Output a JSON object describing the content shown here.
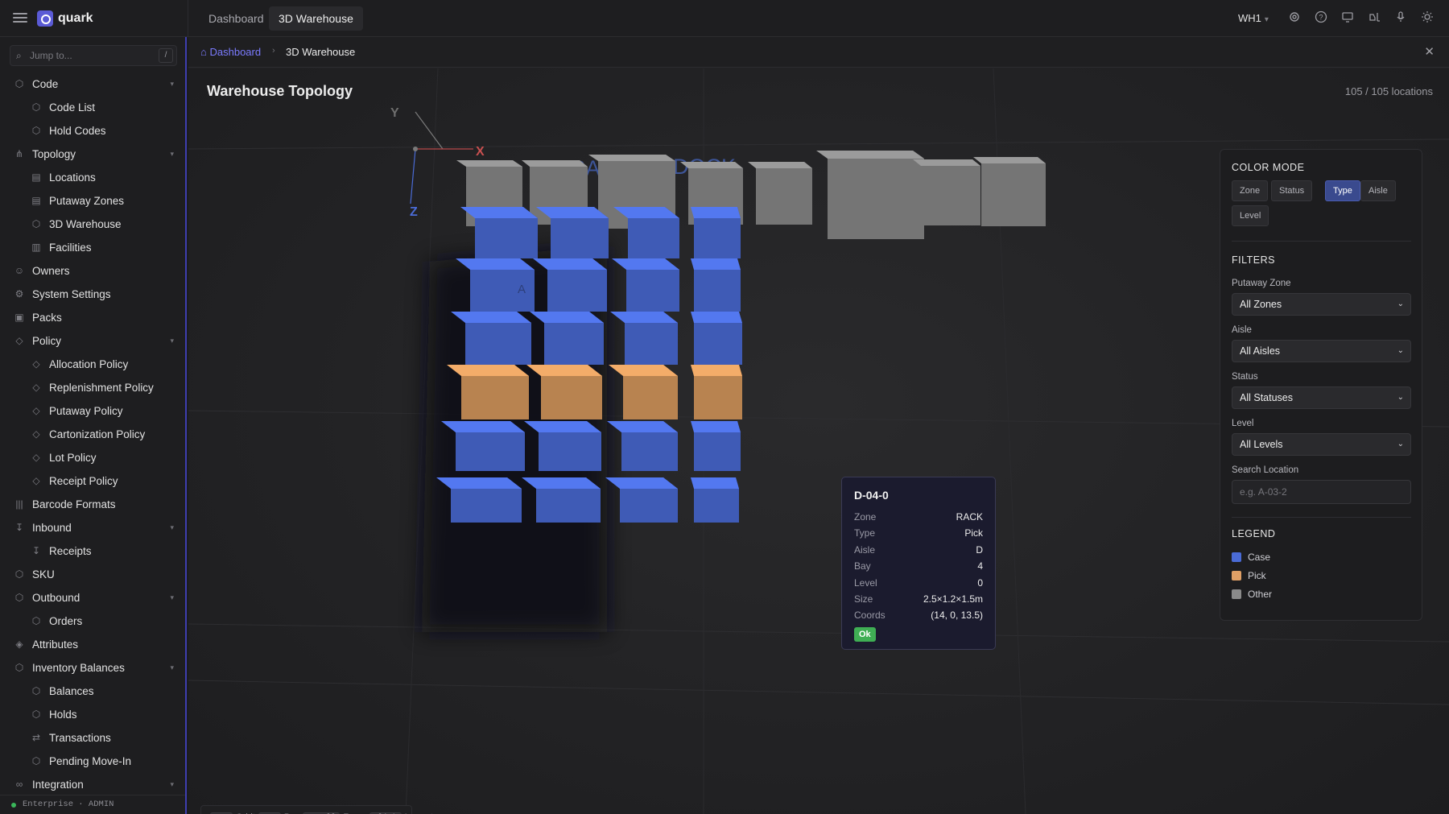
{
  "app": {
    "name": "quark",
    "warehouse": "WH1"
  },
  "top_tabs": [
    {
      "label": "Dashboard"
    },
    {
      "label": "3D Warehouse"
    }
  ],
  "sidebar": {
    "search_placeholder": "Jump to...",
    "search_shortcut": "/",
    "items": [
      {
        "label": "Code",
        "level": 0,
        "icon": "cube-icon",
        "expandable": true
      },
      {
        "label": "Code List",
        "level": 1,
        "icon": "cube-icon"
      },
      {
        "label": "Hold Codes",
        "level": 1,
        "icon": "cube-icon"
      },
      {
        "label": "Topology",
        "level": 0,
        "icon": "topology-icon",
        "expandable": true
      },
      {
        "label": "Locations",
        "level": 1,
        "icon": "map-icon"
      },
      {
        "label": "Putaway Zones",
        "level": 1,
        "icon": "map-icon"
      },
      {
        "label": "3D Warehouse",
        "level": 1,
        "icon": "cube-icon"
      },
      {
        "label": "Facilities",
        "level": 1,
        "icon": "chart-icon"
      },
      {
        "label": "Owners",
        "level": 0,
        "icon": "users-icon"
      },
      {
        "label": "System Settings",
        "level": 0,
        "icon": "gear-icon"
      },
      {
        "label": "Packs",
        "level": 0,
        "icon": "package-icon"
      },
      {
        "label": "Policy",
        "level": 0,
        "icon": "shield-icon",
        "expandable": true
      },
      {
        "label": "Allocation Policy",
        "level": 1,
        "icon": "shield-icon"
      },
      {
        "label": "Replenishment Policy",
        "level": 1,
        "icon": "shield-icon"
      },
      {
        "label": "Putaway Policy",
        "level": 1,
        "icon": "shield-icon"
      },
      {
        "label": "Cartonization Policy",
        "level": 1,
        "icon": "shield-icon"
      },
      {
        "label": "Lot Policy",
        "level": 1,
        "icon": "shield-icon"
      },
      {
        "label": "Receipt Policy",
        "level": 1,
        "icon": "shield-icon"
      },
      {
        "label": "Barcode Formats",
        "level": 0,
        "icon": "barcode-icon"
      },
      {
        "label": "Inbound",
        "level": 0,
        "icon": "arrow-down-icon",
        "expandable": true
      },
      {
        "label": "Receipts",
        "level": 1,
        "icon": "arrow-down-icon"
      },
      {
        "label": "SKU",
        "level": 0,
        "icon": "cube-icon"
      },
      {
        "label": "Outbound",
        "level": 0,
        "icon": "cube-icon",
        "expandable": true
      },
      {
        "label": "Orders",
        "level": 1,
        "icon": "cube-icon"
      },
      {
        "label": "Attributes",
        "level": 0,
        "icon": "tag-icon"
      },
      {
        "label": "Inventory Balances",
        "level": 0,
        "icon": "cube-icon",
        "expandable": true
      },
      {
        "label": "Balances",
        "level": 1,
        "icon": "cube-icon"
      },
      {
        "label": "Holds",
        "level": 1,
        "icon": "cube-icon"
      },
      {
        "label": "Transactions",
        "level": 1,
        "icon": "transactions-icon"
      },
      {
        "label": "Pending Move-In",
        "level": 1,
        "icon": "cube-icon"
      },
      {
        "label": "Integration",
        "level": 0,
        "icon": "link-icon",
        "expandable": true
      }
    ],
    "footer": "Enterprise · ADMIN"
  },
  "breadcrumb": {
    "home": "Dashboard",
    "current": "3D Warehouse"
  },
  "viewport": {
    "title": "Warehouse Topology",
    "count": "105 / 105 locations",
    "axes": {
      "x": "X",
      "y": "Y",
      "z": "Z"
    },
    "zone_labels": {
      "rack": "RACK",
      "dock": "DOCK",
      "fragment": "A"
    }
  },
  "tooltip": {
    "title": "D-04-0",
    "rows": [
      {
        "key": "Zone",
        "value": "RACK"
      },
      {
        "key": "Type",
        "value": "Pick"
      },
      {
        "key": "Aisle",
        "value": "D"
      },
      {
        "key": "Bay",
        "value": "4"
      },
      {
        "key": "Level",
        "value": "0"
      },
      {
        "key": "Size",
        "value": "2.5×1.2×1.5m"
      },
      {
        "key": "Coords",
        "value": "(14, 0, 13.5)"
      }
    ],
    "status": "Ok"
  },
  "controls_hint": [
    {
      "key": "LMB",
      "action": "Orbit"
    },
    {
      "key": "RMB",
      "action": "Pan"
    },
    {
      "key": "Scroll",
      "action": "Zoom"
    },
    {
      "key": "Click",
      "action": "Inspect"
    }
  ],
  "panel": {
    "color_mode": {
      "title": "COLOR MODE",
      "options": [
        "Zone",
        "Status",
        "Type",
        "Aisle",
        "Level"
      ],
      "active": "Type"
    },
    "filters": {
      "title": "FILTERS",
      "putaway_zone": {
        "label": "Putaway Zone",
        "value": "All Zones"
      },
      "aisle": {
        "label": "Aisle",
        "value": "All Aisles"
      },
      "status": {
        "label": "Status",
        "value": "All Statuses"
      },
      "level": {
        "label": "Level",
        "value": "All Levels"
      },
      "search": {
        "label": "Search Location",
        "placeholder": "e.g. A-03-2"
      }
    },
    "legend": {
      "title": "LEGEND",
      "items": [
        {
          "label": "Case",
          "color": "#4a6bd6"
        },
        {
          "label": "Pick",
          "color": "#e0a066"
        },
        {
          "label": "Other",
          "color": "#8a8a8a"
        }
      ]
    }
  },
  "colors": {
    "accent": "#5b5bd6",
    "case": "#4a6bd6",
    "pick": "#d99a5e",
    "other": "#8a8a8a",
    "ok": "#3fae54"
  }
}
